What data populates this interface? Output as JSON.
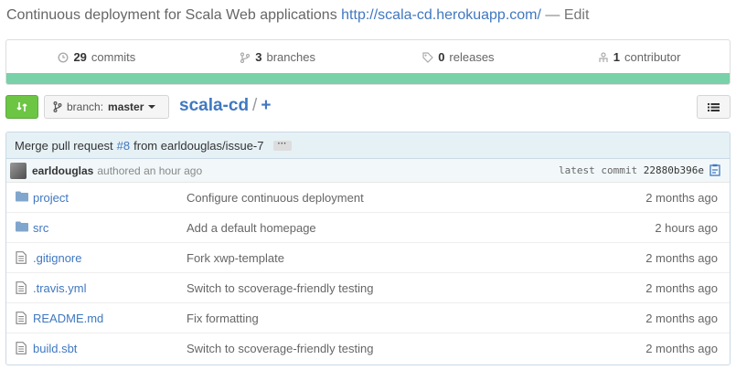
{
  "description": {
    "text": "Continuous deployment for Scala Web applications",
    "url": "http://scala-cd.herokuapp.com/",
    "edit": "— Edit"
  },
  "summary": {
    "commits": {
      "count": "29",
      "label": "commits",
      "icon": "history-icon"
    },
    "branches": {
      "count": "3",
      "label": "branches",
      "icon": "branch-icon"
    },
    "releases": {
      "count": "0",
      "label": "releases",
      "icon": "tag-icon"
    },
    "contributors": {
      "count": "1",
      "label": "contributor",
      "icon": "organization-icon"
    },
    "language_bar_color": "#78d1a8"
  },
  "toolbar": {
    "compare_icon": "compare-icon",
    "branch_prefix": "branch:",
    "branch_name": "master",
    "repo_name": "scala-cd",
    "separator": "/",
    "add": "+",
    "list_icon": "list-icon"
  },
  "latest_commit": {
    "message_prefix": "Merge pull request",
    "pr": "#8",
    "message_suffix": "from earldouglas/issue-7",
    "ellipsis": "···",
    "author": "earldouglas",
    "authored": "authored an hour ago",
    "label": "latest commit",
    "sha": "22880b396e"
  },
  "files": [
    {
      "type": "dir",
      "name": "project",
      "message": "Configure continuous deployment",
      "age": "2 months ago"
    },
    {
      "type": "dir",
      "name": "src",
      "message": "Add a default homepage",
      "age": "2 hours ago"
    },
    {
      "type": "file",
      "name": ".gitignore",
      "message": "Fork xwp-template",
      "age": "2 months ago"
    },
    {
      "type": "file",
      "name": ".travis.yml",
      "message": "Switch to scoverage-friendly testing",
      "age": "2 months ago"
    },
    {
      "type": "file",
      "name": "README.md",
      "message": "Fix formatting",
      "age": "2 months ago"
    },
    {
      "type": "file",
      "name": "build.sbt",
      "message": "Switch to scoverage-friendly testing",
      "age": "2 months ago"
    }
  ],
  "colors": {
    "link": "#4078c0",
    "green": "#6cc644",
    "folder": "#80a6cd"
  }
}
